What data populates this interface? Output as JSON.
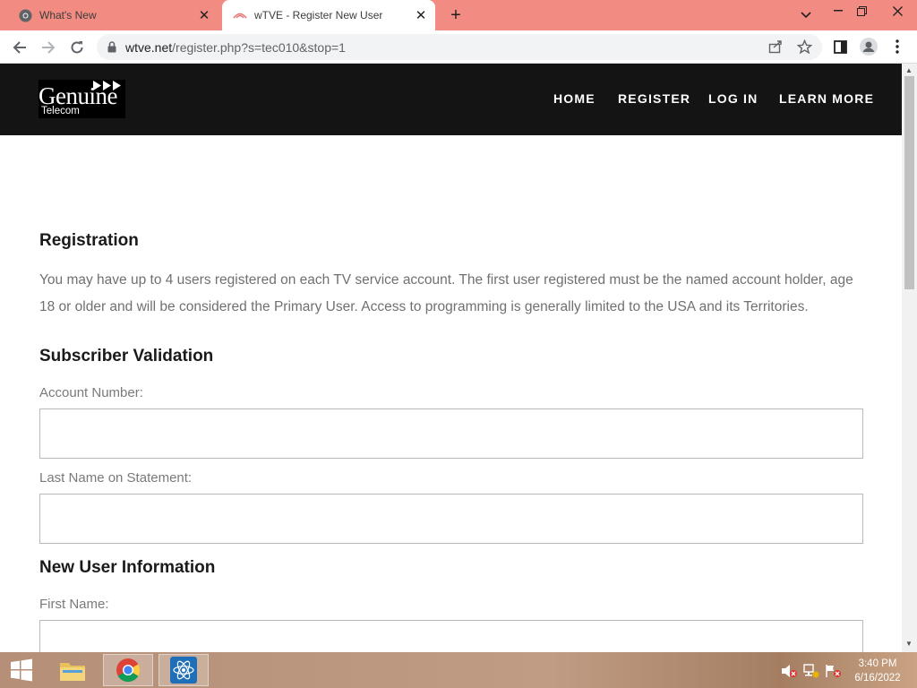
{
  "browser": {
    "tabs": [
      {
        "title": "What's New",
        "active": false,
        "favicon": "chrome-icon"
      },
      {
        "title": "wTVE - Register New User",
        "active": true,
        "favicon": "wtve-icon"
      }
    ],
    "address": {
      "host": "wtve.net",
      "path": "/register.php?s=tec010&stop=1"
    }
  },
  "site": {
    "logo": {
      "wordmark": "Genuine",
      "subtitle": "Telecom"
    },
    "nav": [
      "HOME",
      "REGISTER",
      "LOG IN",
      "LEARN MORE"
    ]
  },
  "page": {
    "registration": {
      "heading": "Registration",
      "text": "You may have up to 4 users registered on each TV service account. The first user registered must be the named account holder, age 18 or older and will be considered the Primary User. Access to programming is generally limited to the USA and its Territories."
    },
    "subscriber_validation": {
      "heading": "Subscriber Validation",
      "account_number_label": "Account Number:",
      "account_number_value": "",
      "last_name_label": "Last Name on Statement:",
      "last_name_value": ""
    },
    "new_user": {
      "heading": "New User Information",
      "first_name_label": "First Name:",
      "first_name_value": ""
    }
  },
  "taskbar": {
    "time": "3:40 PM",
    "date": "6/16/2022"
  },
  "colors": {
    "tabstrip": "#f28b82",
    "site_header": "#141414",
    "heading": "#1a1a1a",
    "body_text": "#707070"
  }
}
